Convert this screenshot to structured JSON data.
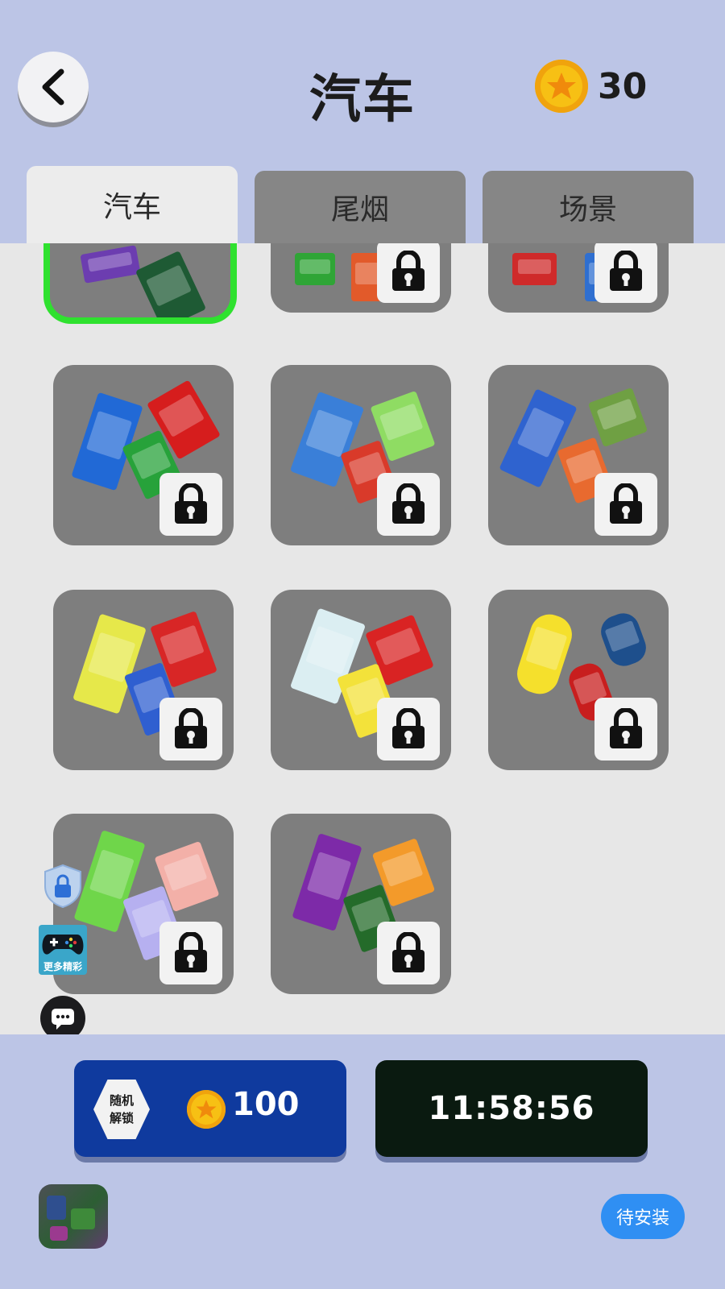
{
  "header": {
    "title": "汽车",
    "coins": "30"
  },
  "tabs": [
    {
      "label": "汽车",
      "active": true
    },
    {
      "label": "尾烟",
      "active": false
    },
    {
      "label": "场景",
      "active": false
    }
  ],
  "grid": {
    "selected_index": 0,
    "items": [
      {
        "name": "car-set-1",
        "locked": false
      },
      {
        "name": "car-set-2",
        "locked": true
      },
      {
        "name": "car-set-3",
        "locked": true
      },
      {
        "name": "car-set-4",
        "locked": true
      },
      {
        "name": "car-set-5",
        "locked": true
      },
      {
        "name": "car-set-6",
        "locked": true
      },
      {
        "name": "car-set-7",
        "locked": true
      },
      {
        "name": "car-set-8",
        "locked": true
      },
      {
        "name": "car-set-9",
        "locked": true
      },
      {
        "name": "car-set-10",
        "locked": true
      },
      {
        "name": "car-set-11",
        "locked": true
      }
    ]
  },
  "overlay": {
    "more_games_label": "更多精彩"
  },
  "bottom": {
    "random_unlock_line1": "随机",
    "random_unlock_line2": "解锁",
    "random_unlock_price": "100",
    "timer": "11:58:56",
    "install_label": "待安装"
  },
  "colors": {
    "accent_selected": "#2fe12f",
    "unlock_button": "#0f3a9e",
    "timer_button": "#0a1a10",
    "install_button": "#2f8ff3"
  }
}
